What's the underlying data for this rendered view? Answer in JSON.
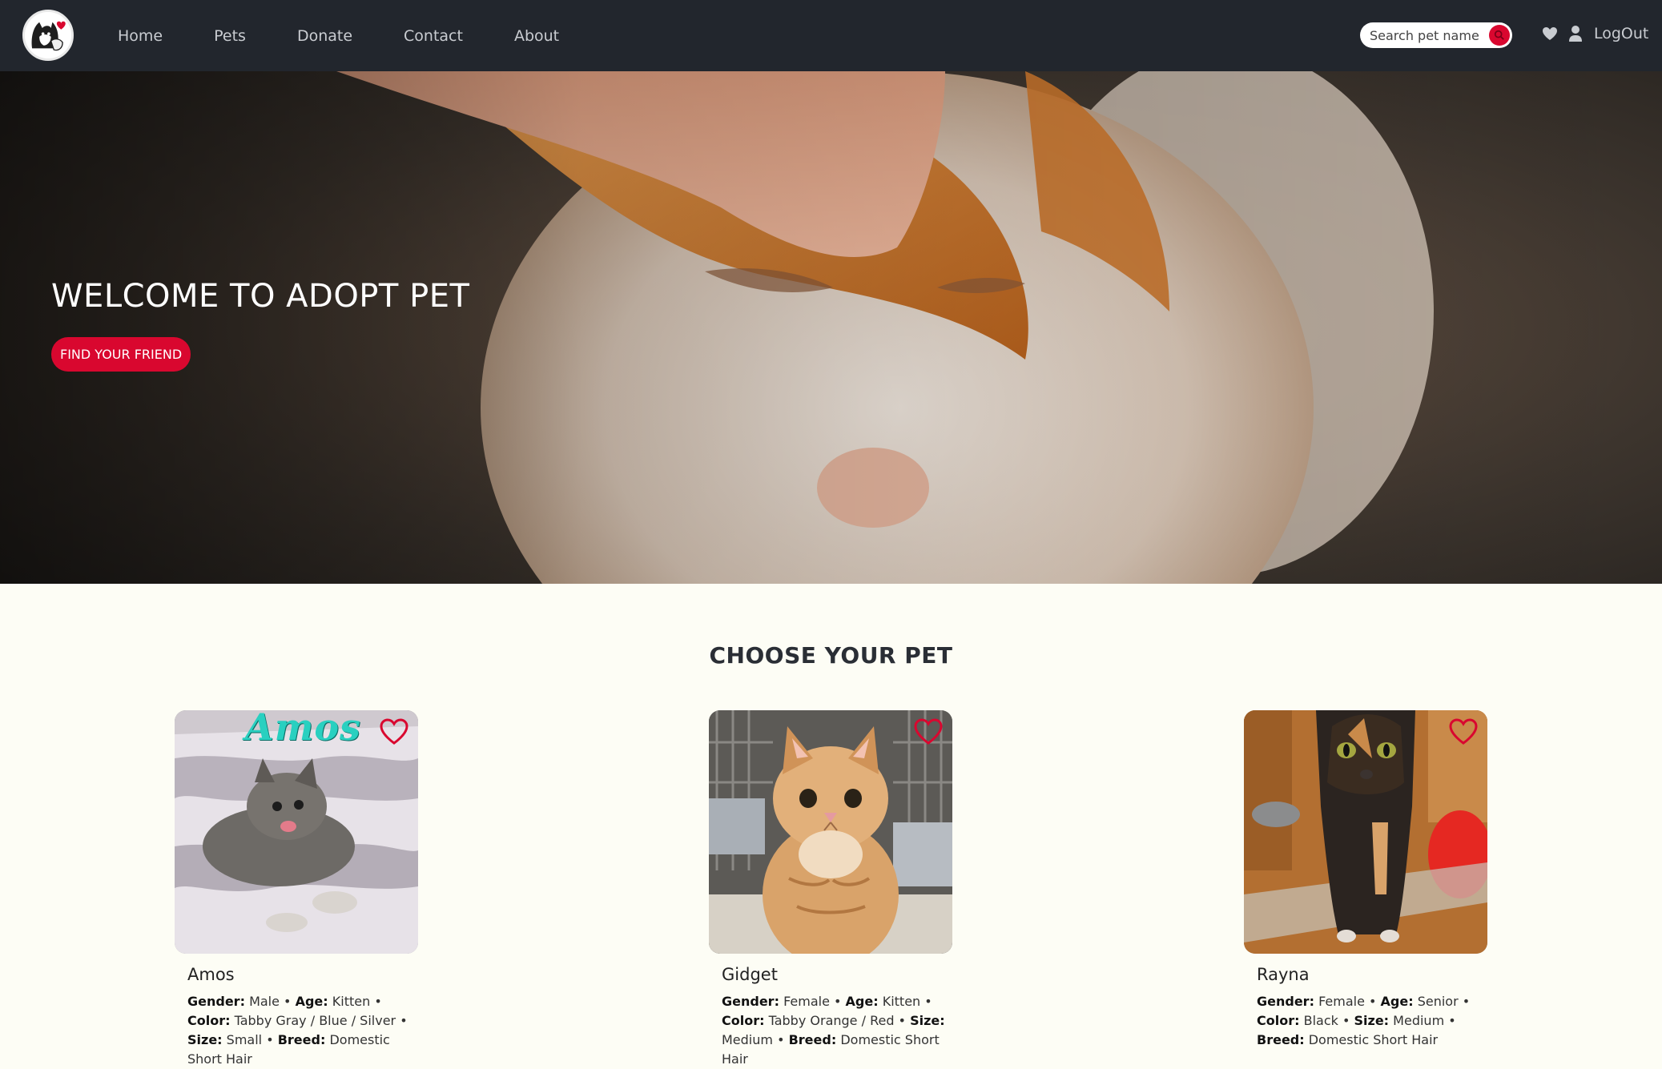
{
  "nav": {
    "links": [
      "Home",
      "Pets",
      "Donate",
      "Contact",
      "About"
    ],
    "search_placeholder": "Search pet name",
    "logout_label": "LogOut",
    "icons": [
      "favorites-heart-icon",
      "user-icon",
      "search-icon"
    ]
  },
  "hero": {
    "title": "WELCOME TO ADOPT PET",
    "button_label": "FIND YOUR FRIEND"
  },
  "section": {
    "title": "CHOOSE YOUR PET"
  },
  "pets": [
    {
      "name": "Amos",
      "photo_caption": "Amos",
      "gender": "Male",
      "age": "Kitten",
      "color": "Tabby Gray / Blue / Silver",
      "size": "Small",
      "breed": "Domestic Short Hair"
    },
    {
      "name": "Gidget",
      "gender": "Female",
      "age": "Kitten",
      "color": "Tabby Orange / Red",
      "size": "Medium",
      "breed": "Domestic Short Hair"
    },
    {
      "name": "Rayna",
      "gender": "Female",
      "age": "Senior",
      "color": "Black",
      "size": "Medium",
      "breed": "Domestic Short Hair"
    }
  ],
  "labels": {
    "gender": "Gender:",
    "age": "Age:",
    "color": "Color:",
    "size": "Size:",
    "breed": "Breed:",
    "sep": " • "
  },
  "colors": {
    "navbar": "#22262d",
    "accent": "#d9072f",
    "page_bg": "#fdfdf5"
  }
}
